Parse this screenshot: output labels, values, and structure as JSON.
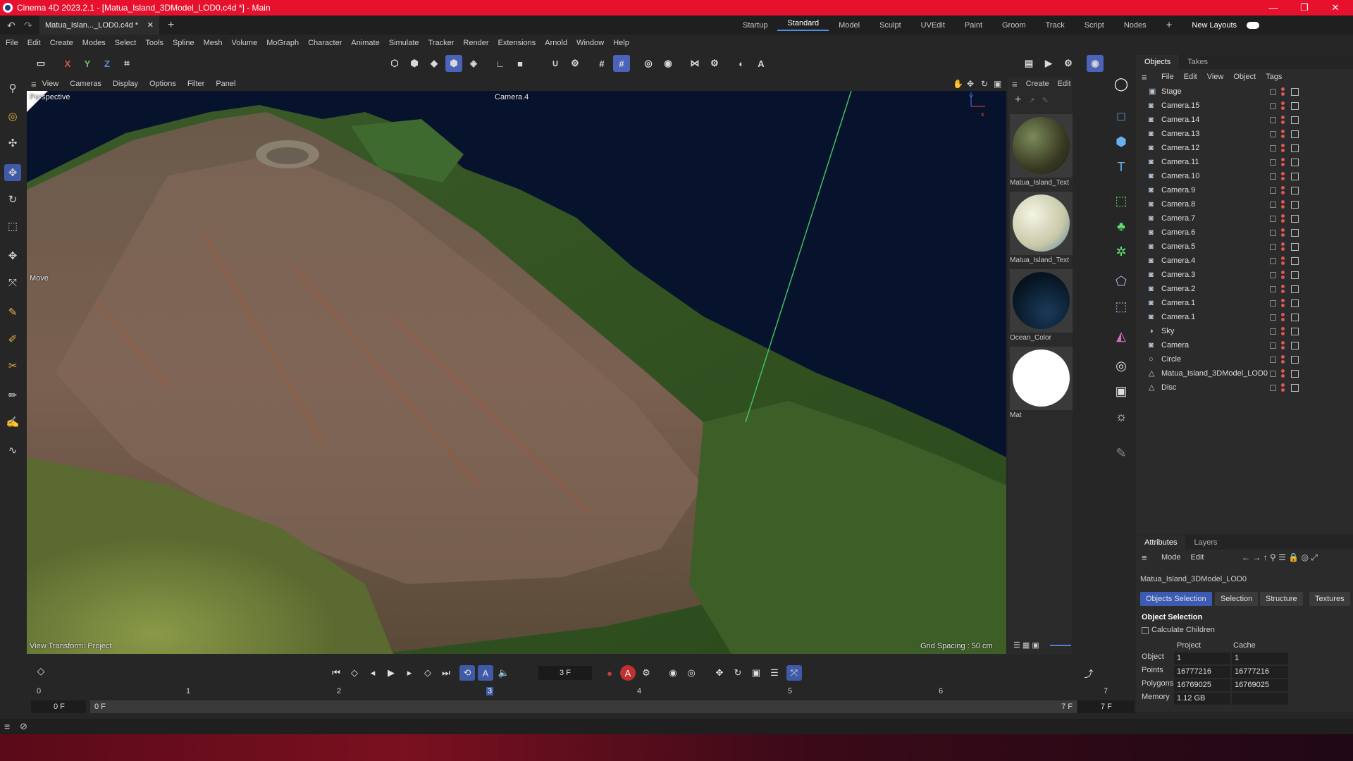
{
  "app": {
    "title": "Cinema 4D 2023.2.1 - [Matua_Island_3DModel_LOD0.c4d *] - Main",
    "window_controls": [
      "—",
      "❐",
      "✕"
    ]
  },
  "doc_tab": {
    "label": "Matua_Islan..._LOD0.c4d *",
    "close": "✕",
    "add": "+"
  },
  "layouts": [
    "Startup",
    "Standard",
    "Model",
    "Sculpt",
    "UVEdit",
    "Paint",
    "Groom",
    "Track",
    "Script",
    "Nodes"
  ],
  "active_layout": "Standard",
  "new_layouts": "New Layouts",
  "menu": [
    "File",
    "Edit",
    "Create",
    "Modes",
    "Select",
    "Tools",
    "Spline",
    "Mesh",
    "Volume",
    "MoGraph",
    "Character",
    "Animate",
    "Simulate",
    "Tracker",
    "Render",
    "Extensions",
    "Arnold",
    "Window",
    "Help"
  ],
  "axis_buttons": [
    "X",
    "Y",
    "Z"
  ],
  "viewport": {
    "menu": [
      "View",
      "Cameras",
      "Display",
      "Options",
      "Filter",
      "Panel"
    ],
    "label_perspective": "Perspective",
    "camera_label": "Camera.4",
    "move_label": "Move",
    "view_transform": "View Transform: Project",
    "grid_spacing": "Grid Spacing : 50 cm"
  },
  "materials": {
    "menu": [
      "Create",
      "Edit"
    ],
    "items": [
      {
        "name": "Matua_Island_Text",
        "color": "#4a4a2a"
      },
      {
        "name": "Matua_Island_Text",
        "color": "#d8d8c0"
      },
      {
        "name": "Ocean_Color",
        "color": "#0a1a2a"
      },
      {
        "name": "Mat",
        "color": "#ffffff"
      }
    ]
  },
  "objects_panel": {
    "tabs": [
      "Objects",
      "Takes"
    ],
    "menu": [
      "File",
      "Edit",
      "View",
      "Object",
      "Tags"
    ],
    "rows": [
      {
        "name": "Stage",
        "icon": "stage-icon"
      },
      {
        "name": "Camera.15",
        "icon": "camera-icon"
      },
      {
        "name": "Camera.14",
        "icon": "camera-icon"
      },
      {
        "name": "Camera.13",
        "icon": "camera-icon"
      },
      {
        "name": "Camera.12",
        "icon": "camera-icon"
      },
      {
        "name": "Camera.11",
        "icon": "camera-icon"
      },
      {
        "name": "Camera.10",
        "icon": "camera-icon"
      },
      {
        "name": "Camera.9",
        "icon": "camera-icon"
      },
      {
        "name": "Camera.8",
        "icon": "camera-icon"
      },
      {
        "name": "Camera.7",
        "icon": "camera-icon"
      },
      {
        "name": "Camera.6",
        "icon": "camera-icon"
      },
      {
        "name": "Camera.5",
        "icon": "camera-icon"
      },
      {
        "name": "Camera.4",
        "icon": "camera-icon"
      },
      {
        "name": "Camera.3",
        "icon": "camera-icon"
      },
      {
        "name": "Camera.2",
        "icon": "camera-icon"
      },
      {
        "name": "Camera.1",
        "icon": "camera-icon"
      },
      {
        "name": "Camera.1",
        "icon": "camera-icon"
      },
      {
        "name": "Sky",
        "icon": "sky-icon"
      },
      {
        "name": "Camera",
        "icon": "camera-icon"
      },
      {
        "name": "Circle",
        "icon": "circle-icon"
      },
      {
        "name": "Matua_Island_3DModel_LOD0",
        "icon": "mesh-icon"
      },
      {
        "name": "Disc",
        "icon": "disc-icon"
      }
    ]
  },
  "attributes": {
    "tabs": [
      "Attributes",
      "Layers"
    ],
    "menu": [
      "Mode",
      "Edit"
    ],
    "object_name": "Matua_Island_3DModel_LOD0",
    "buttons": [
      "Objects Selection",
      "Selection",
      "Structure",
      "Textures"
    ],
    "section": "Object Selection",
    "calc_children": "Calculate Children",
    "col_project": "Project",
    "col_cache": "Cache",
    "stats": [
      {
        "label": "Object",
        "project": "1",
        "cache": "1"
      },
      {
        "label": "Points",
        "project": "16777216",
        "cache": "16777216"
      },
      {
        "label": "Polygons",
        "project": "16769025",
        "cache": "16769025"
      },
      {
        "label": "Memory",
        "project": "1.12 GB",
        "cache": ""
      }
    ]
  },
  "timeline": {
    "current_frame": "3 F",
    "ticks": [
      "0",
      "1",
      "2",
      "3",
      "4",
      "5",
      "6",
      "7"
    ],
    "start_left": "0 F",
    "start_inner": "0 F",
    "end_inner": "7 F",
    "end_right": "7 F"
  },
  "colors": {
    "titlebar": "#e8112d",
    "accent": "#3f5ba8"
  }
}
